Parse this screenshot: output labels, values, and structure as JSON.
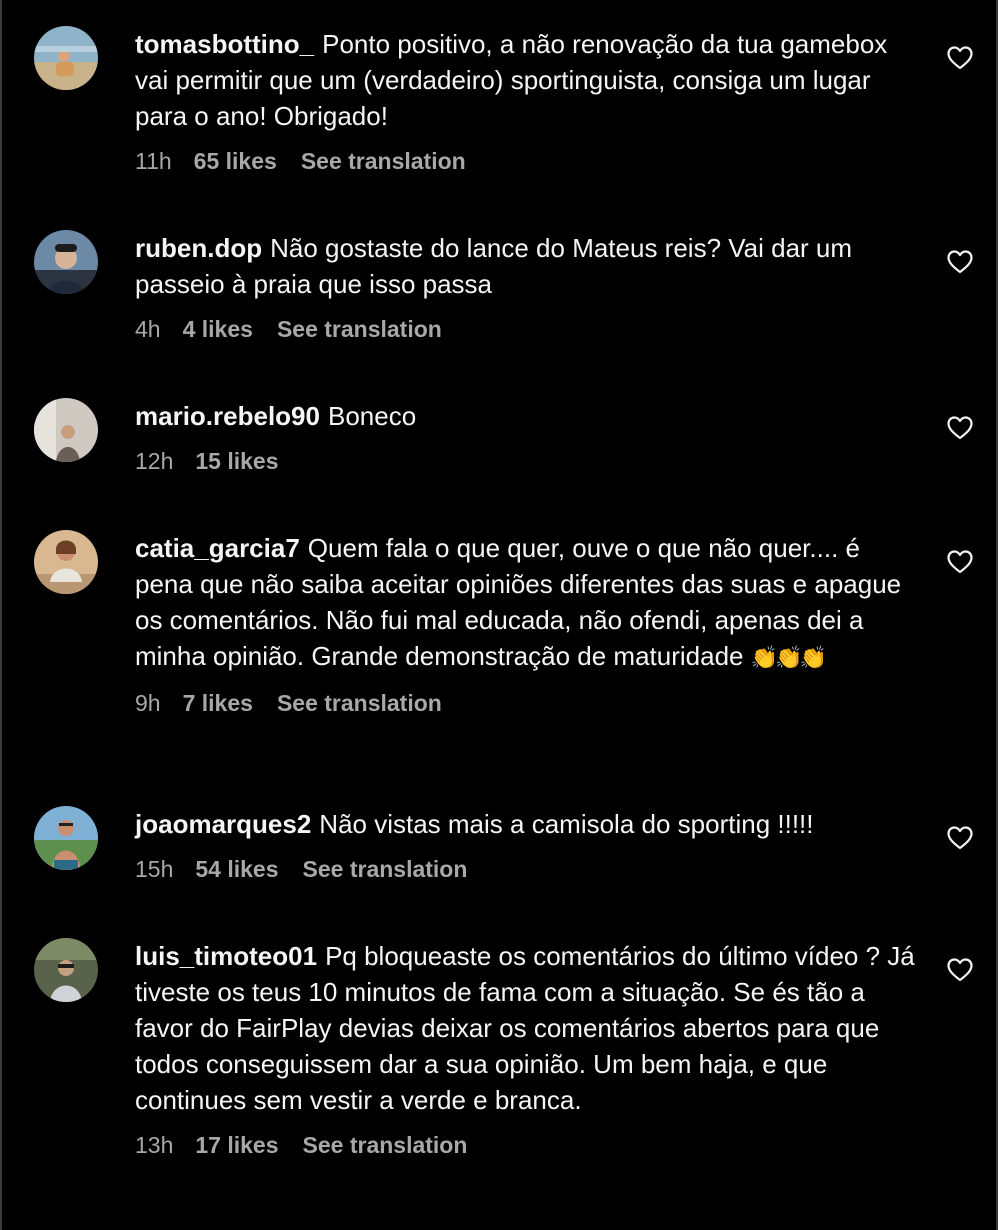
{
  "comments": [
    {
      "username": "tomasbottino_",
      "text": "Ponto positivo, a não renovação da tua gamebox vai permitir que um (verdadeiro) sportinguista, consiga um lugar para o ano! Obrigado!",
      "time": "11h",
      "likes": "65 likes",
      "action": "See translation",
      "avatar": "avatar-beach-person"
    },
    {
      "username": "ruben.dop",
      "text": "Não gostaste do lance do Mateus reis? Vai dar um passeio à praia que isso passa",
      "time": "4h",
      "likes": "4 likes",
      "action": "See translation",
      "avatar": "avatar-man-portrait"
    },
    {
      "username": "mario.rebelo90",
      "text": "Boneco",
      "time": "12h",
      "likes": "15 likes",
      "action": "",
      "avatar": "avatar-person-indoor"
    },
    {
      "username": "catia_garcia7",
      "text": "Quem fala o que quer, ouve o que não quer.... é pena que não saiba aceitar opiniões diferentes das suas e apague os comentários. Não fui mal educada, não ofendi, apenas dei a minha opinião. Grande demonstração de maturidade",
      "emoji": "👏👏👏",
      "time": "9h",
      "likes": "7 likes",
      "action": "See translation",
      "avatar": "avatar-woman-sitting"
    },
    {
      "username": "joaomarques2",
      "text": "Não vistas mais a camisola do sporting !!!!!",
      "time": "15h",
      "likes": "54 likes",
      "action": "See translation",
      "avatar": "avatar-man-shirtless"
    },
    {
      "username": "luis_timoteo01",
      "text": "Pq bloqueaste os comentários do último vídeo ? Já tiveste os teus 10 minutos de fama com a situação. Se és tão a favor do FairPlay devias deixar os comentários abertos para que todos conseguissem dar a sua opinião. Um bem haja, e que continues sem vestir a verde e branca.",
      "time": "13h",
      "likes": "17 likes",
      "action": "See translation",
      "avatar": "avatar-man-outdoor"
    }
  ],
  "colors": {
    "background": "#000000",
    "text": "#f5f5f5",
    "secondary": "#a8a8a8"
  },
  "icons": {
    "like": "heart-outline-icon"
  }
}
